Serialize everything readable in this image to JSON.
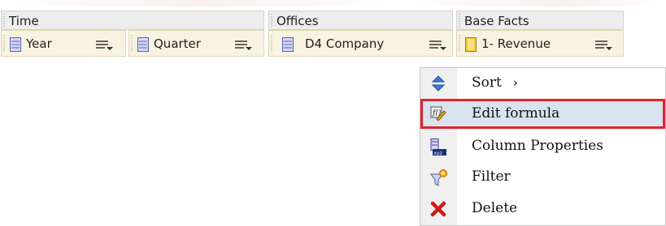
{
  "headers": {
    "time": "Time",
    "offices": "Offices",
    "base_facts": "Base Facts"
  },
  "columns": [
    {
      "label": "Year",
      "icon": "dimension-column-icon"
    },
    {
      "label": "Quarter",
      "icon": "dimension-column-icon"
    },
    {
      "label": "D4 Company",
      "icon": "dimension-column-icon"
    },
    {
      "label": "1- Revenue",
      "icon": "measure-column-icon"
    }
  ],
  "context_menu": {
    "items": [
      {
        "label": "Sort",
        "icon": "sort-icon",
        "has_submenu": true,
        "submenu_glyph": "›"
      },
      {
        "label": "Edit formula",
        "icon": "edit-formula-icon",
        "selected": true
      },
      {
        "label": "Column Properties",
        "icon": "column-properties-icon"
      },
      {
        "label": "Filter",
        "icon": "filter-icon"
      },
      {
        "label": "Delete",
        "icon": "delete-icon"
      }
    ]
  },
  "colors": {
    "highlight_border": "#e3222b",
    "pill_background": "#f8f3e0",
    "header_background": "#ededed"
  }
}
